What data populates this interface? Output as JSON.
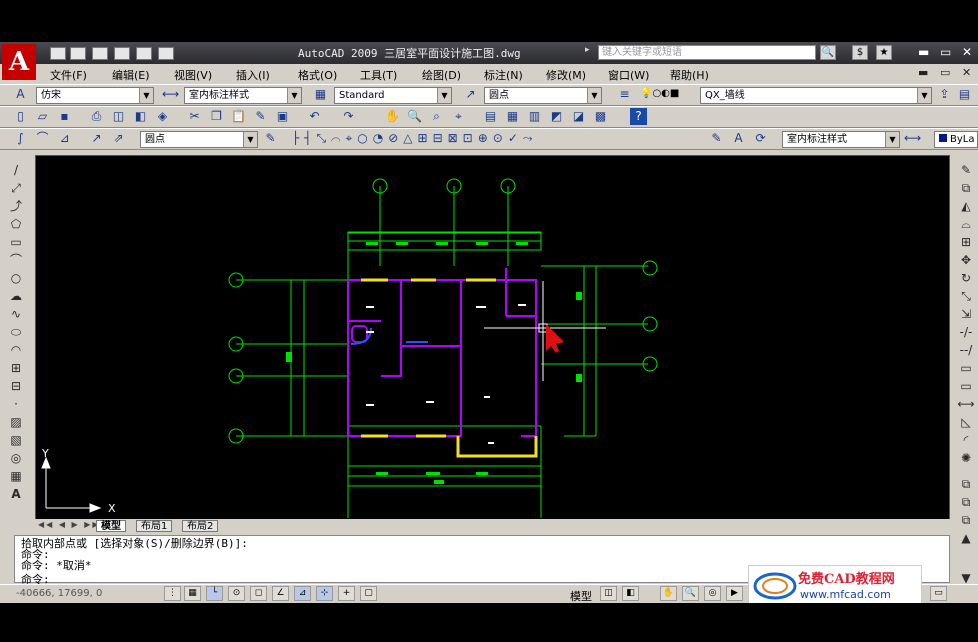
{
  "window": {
    "title": "AutoCAD 2009 三居室平面设计施工图.dwg",
    "search_placeholder": "键入关键字或短语",
    "logo": "A"
  },
  "menu": [
    "文件(F)",
    "编辑(E)",
    "视图(V)",
    "插入(I)",
    "格式(O)",
    "工具(T)",
    "绘图(D)",
    "标注(N)",
    "修改(M)",
    "窗口(W)",
    "帮助(H)"
  ],
  "styles_toolbar": {
    "text_style": "仿宋",
    "dim_style": "室内标注样式",
    "table_style": "Standard",
    "multileader_style": "圆点",
    "layer": "QX_墙线"
  },
  "dim_toolbar": {
    "leader_style": "圆点",
    "dim_style": "室内标注样式",
    "color": "ByLa"
  },
  "layout_tabs": [
    "模型",
    "布局1",
    "布局2"
  ],
  "command_lines": [
    "拾取内部点或 [选择对象(S)/删除边界(B)]:",
    "命令:",
    "命令: *取消*",
    "命令:"
  ],
  "status": {
    "coords": "-40666, 17699, 0",
    "model_label": "模型"
  },
  "watermark": {
    "title": "免费CAD教程网",
    "url": "www.mfcad.com"
  },
  "ucs": {
    "y_label": "Y",
    "x_label": "X"
  },
  "axis_labels": [
    "1",
    "2",
    "3",
    "A",
    "B",
    "C",
    "D",
    "E",
    "F",
    "G"
  ],
  "colors": {
    "dim_green": "#00e000",
    "wall_magenta": "#b000ff",
    "window_yellow": "#f0e020",
    "canvas_bg": "#000000",
    "crosshair_white": "#ffffff",
    "cursor_red": "#e01010"
  }
}
